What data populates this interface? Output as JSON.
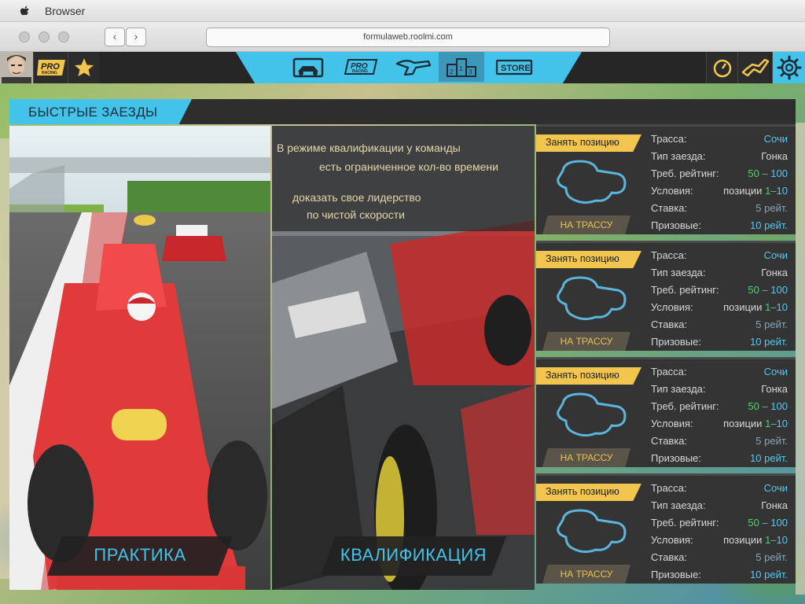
{
  "window": {
    "app_title": "Browser"
  },
  "browser": {
    "url": "formulaweb.roolmi.com",
    "back": "‹",
    "forward": "›"
  },
  "topbar": {
    "pro_badge_text": "PRO",
    "pro_badge_sub": "RACING",
    "nav": [
      {
        "name": "garage",
        "label": ""
      },
      {
        "name": "pro-racing",
        "label": "PRO",
        "sub": "RACING"
      },
      {
        "name": "tuning",
        "label": ""
      },
      {
        "name": "rating",
        "label": "2 1 3",
        "active": true
      },
      {
        "name": "store",
        "label": "STORE"
      }
    ]
  },
  "panel": {
    "title": "БЫСТРЫЕ ЗАЕЗДЫ",
    "practice_label": "ПРАКТИКА",
    "qualification_label": "КВАЛИФИКАЦИЯ",
    "qualification_text": {
      "line1": "В режиме квалификации у команды",
      "line2": "есть ограниченное кол-во времени",
      "line3": "доказать свое лидерство",
      "line4": "по чистой скорости"
    }
  },
  "races": [
    {
      "take_position": "Занять позицию",
      "go_button": "НА ТРАССУ",
      "track_label": "Трасса:",
      "track": "Сочи",
      "type_label": "Тип заезда:",
      "type": "Гонка",
      "rating_label": "Треб. рейтинг:",
      "rating_min": "50",
      "rating_dash": " – ",
      "rating_max": "100",
      "conditions_label": "Условия:",
      "conditions_prefix": "позиции ",
      "pos_min": "1",
      "pos_dash": "–",
      "pos_max": "10",
      "stake_label": "Ставка:",
      "stake": "5 рейт.",
      "prize_label": "Призовые:",
      "prize": "10 рейт."
    },
    {
      "take_position": "Занять позицию",
      "go_button": "НА ТРАССУ",
      "track_label": "Трасса:",
      "track": "Сочи",
      "type_label": "Тип заезда:",
      "type": "Гонка",
      "rating_label": "Треб. рейтинг:",
      "rating_min": "50",
      "rating_dash": " – ",
      "rating_max": "100",
      "conditions_label": "Условия:",
      "conditions_prefix": "позиции ",
      "pos_min": "1",
      "pos_dash": "–",
      "pos_max": "10",
      "stake_label": "Ставка:",
      "stake": "5 рейт.",
      "prize_label": "Призовые:",
      "prize": "10 рейт."
    },
    {
      "take_position": "Занять позицию",
      "go_button": "НА ТРАССУ",
      "track_label": "Трасса:",
      "track": "Сочи",
      "type_label": "Тип заезда:",
      "type": "Гонка",
      "rating_label": "Треб. рейтинг:",
      "rating_min": "50",
      "rating_dash": " – ",
      "rating_max": "100",
      "conditions_label": "Условия:",
      "conditions_prefix": "позиции ",
      "pos_min": "1",
      "pos_dash": "–",
      "pos_max": "10",
      "stake_label": "Ставка:",
      "stake": "5 рейт.",
      "prize_label": "Призовые:",
      "prize": "10 рейт."
    },
    {
      "take_position": "Занять позицию",
      "go_button": "НА ТРАССУ",
      "track_label": "Трасса:",
      "track": "Сочи",
      "type_label": "Тип заезда:",
      "type": "Гонка",
      "rating_label": "Треб. рейтинг:",
      "rating_min": "50",
      "rating_dash": " – ",
      "rating_max": "100",
      "conditions_label": "Условия:",
      "conditions_prefix": "позиции ",
      "pos_min": "1",
      "pos_dash": "–",
      "pos_max": "10",
      "stake_label": "Ставка:",
      "stake": "5 рейт.",
      "prize_label": "Призовые:",
      "prize": "10 рейт."
    }
  ],
  "colors": {
    "accent": "#43c2ea",
    "gold": "#f2c54e",
    "panel": "#2e2e2e",
    "green": "#4fd36b"
  },
  "icons": [
    "apple-icon",
    "star-icon",
    "timer-icon",
    "track-icon",
    "settings-gear-icon"
  ]
}
